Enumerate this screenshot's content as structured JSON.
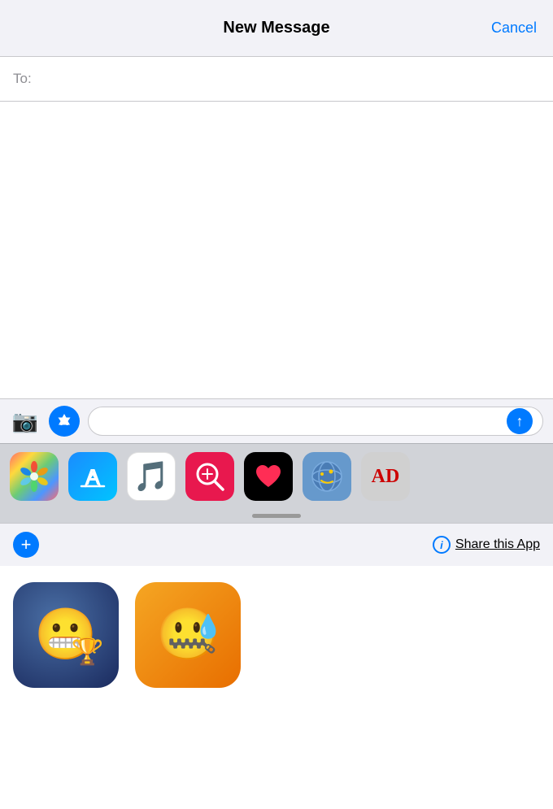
{
  "header": {
    "title": "New Message",
    "cancel_label": "Cancel"
  },
  "to_field": {
    "label": "To:",
    "placeholder": ""
  },
  "input_bar": {
    "message_placeholder": "",
    "send_label": "↑"
  },
  "app_strip": {
    "icons": [
      {
        "name": "photos",
        "label": "Photos"
      },
      {
        "name": "app-store",
        "label": "App Store"
      },
      {
        "name": "music",
        "label": "Music"
      },
      {
        "name": "web-search",
        "label": "Web Search"
      },
      {
        "name": "heart-app",
        "label": "Heart App"
      },
      {
        "name": "globe-app",
        "label": "Globe App"
      },
      {
        "name": "ad-app",
        "label": "AD App"
      }
    ]
  },
  "bottom_bar": {
    "plus_label": "+",
    "info_label": "i",
    "share_text": "Share this App"
  },
  "emoji_apps": [
    {
      "name": "emoji-trophy",
      "emoji": "😬🏆"
    },
    {
      "name": "emoji-nervous",
      "emoji": "😬💧"
    }
  ]
}
